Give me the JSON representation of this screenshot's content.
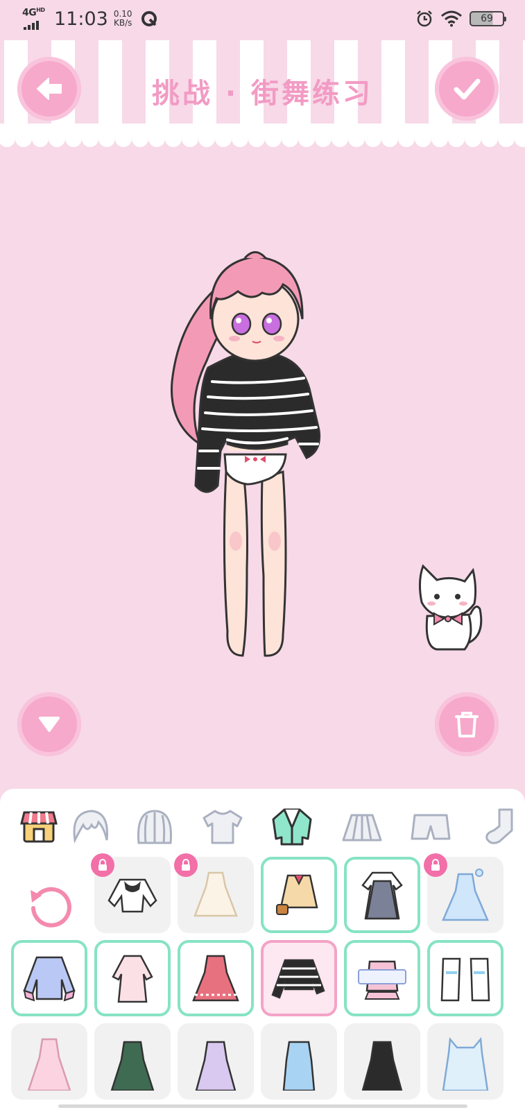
{
  "status_bar": {
    "network_label": "4G",
    "network_sup": "HD",
    "time": "11:03",
    "speed_value": "0.10",
    "speed_unit": "KB/s",
    "battery_level": "69",
    "icons": [
      "signal-icon",
      "q-app-icon",
      "alarm-icon",
      "wifi-icon",
      "battery-icon"
    ]
  },
  "header": {
    "title": "挑战 · 街舞练习",
    "back_icon": "arrow-left-icon",
    "confirm_icon": "checkmark-icon"
  },
  "stage": {
    "left_button_icon": "triangle-down-icon",
    "right_button_icon": "trash-icon",
    "character": "paper-doll-girl",
    "pet": "white-cat"
  },
  "categories": [
    {
      "name": "shop",
      "icon": "shop-icon"
    },
    {
      "name": "bangs",
      "icon": "bangs-hair-icon"
    },
    {
      "name": "hair",
      "icon": "hair-icon"
    },
    {
      "name": "tops",
      "icon": "tshirt-icon"
    },
    {
      "name": "outerwear",
      "icon": "jacket-icon",
      "active": true
    },
    {
      "name": "skirts",
      "icon": "skirt-icon"
    },
    {
      "name": "shorts",
      "icon": "shorts-icon"
    },
    {
      "name": "socks",
      "icon": "sock-icon"
    }
  ],
  "items_row1": [
    {
      "state": "locked",
      "icon": "white-shirt-bra-icon"
    },
    {
      "state": "locked",
      "icon": "lace-dress-icon"
    },
    {
      "state": "owned",
      "icon": "school-uniform-icon"
    },
    {
      "state": "owned",
      "icon": "polka-pinafore-icon"
    },
    {
      "state": "locked",
      "icon": "blue-gown-icon"
    }
  ],
  "items_row2": [
    {
      "state": "owned",
      "icon": "pastel-hoodie-icon"
    },
    {
      "state": "owned",
      "icon": "pink-knit-dress-icon"
    },
    {
      "state": "owned",
      "icon": "red-ruffle-dress-icon"
    },
    {
      "state": "selected",
      "icon": "striped-sweater-icon"
    },
    {
      "state": "owned",
      "icon": "cute-banner-top-icon"
    },
    {
      "state": "owned",
      "icon": "blue-sleeves-icon"
    }
  ],
  "items_row3": [
    {
      "state": "plain",
      "icon": "pink-gown-icon"
    },
    {
      "state": "plain",
      "icon": "green-dress-icon"
    },
    {
      "state": "plain",
      "icon": "lavender-dress-icon"
    },
    {
      "state": "plain",
      "icon": "denim-overall-icon"
    },
    {
      "state": "plain",
      "icon": "black-dress-icon"
    },
    {
      "state": "plain",
      "icon": "cat-ear-dress-icon"
    }
  ],
  "colors": {
    "background": "#f7d9e8",
    "button_pink": "#f6a9cb",
    "title_pink": "#f29bc4",
    "owned_border": "#86e3c4",
    "selected_border": "#f4a3c6",
    "lock_badge": "#f26fa8"
  }
}
